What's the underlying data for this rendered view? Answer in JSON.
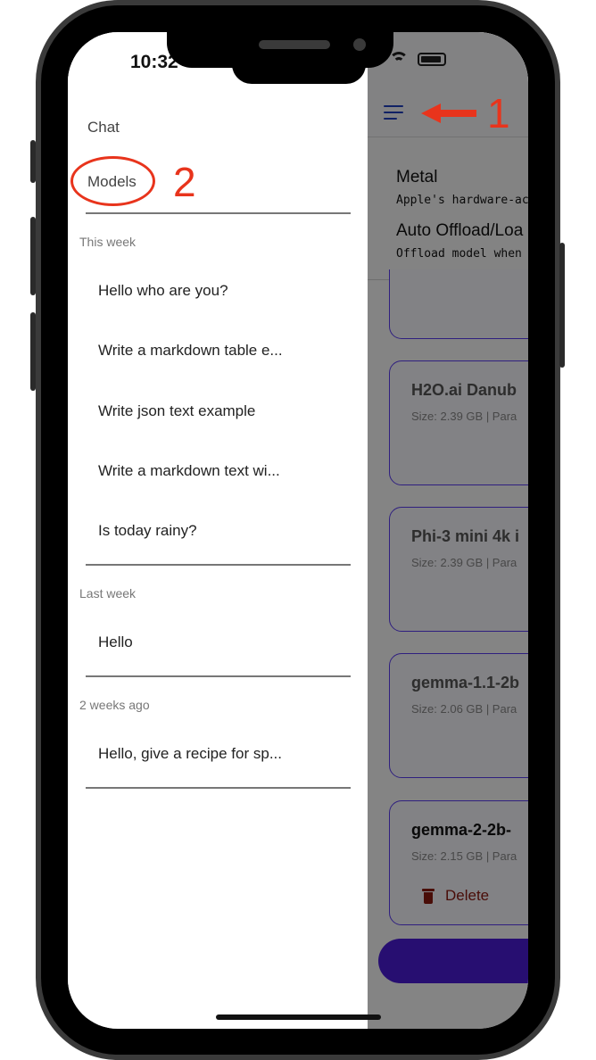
{
  "status_bar": {
    "time": "10:32"
  },
  "drawer": {
    "nav": [
      {
        "label": "Chat"
      },
      {
        "label": "Models"
      }
    ],
    "sections": [
      {
        "label": "This week",
        "items": [
          "Hello who are you?",
          "Write a markdown table e...",
          "Write json text example",
          "Write a markdown text wi...",
          "Is today rainy?"
        ]
      },
      {
        "label": "Last week",
        "items": [
          "Hello"
        ]
      },
      {
        "label": "2 weeks ago",
        "items": [
          "Hello, give a recipe for sp..."
        ]
      }
    ]
  },
  "main": {
    "settings": {
      "metal_title": "Metal",
      "metal_desc": "Apple's hardware-acc",
      "offload_title": "Auto Offload/Loa",
      "offload_desc": "Offload model when a"
    },
    "models": [
      {
        "name": "",
        "info": ""
      },
      {
        "name": "H2O.ai Danub",
        "info": "Size: 2.39 GB | Para"
      },
      {
        "name": "Phi-3 mini 4k i",
        "info": "Size: 2.39 GB | Para"
      },
      {
        "name": "gemma-1.1-2b",
        "info": "Size: 2.06 GB | Para"
      },
      {
        "name": "gemma-2-2b-",
        "info": "Size: 2.15 GB | Para",
        "action": "Delete"
      }
    ]
  },
  "annotations": {
    "arrow_number": "1",
    "circle_number": "2",
    "color": "#e8341c"
  },
  "colors": {
    "accent": "#4a1cd6",
    "card_border": "#5a3cf0",
    "delete": "#8b1a10"
  }
}
